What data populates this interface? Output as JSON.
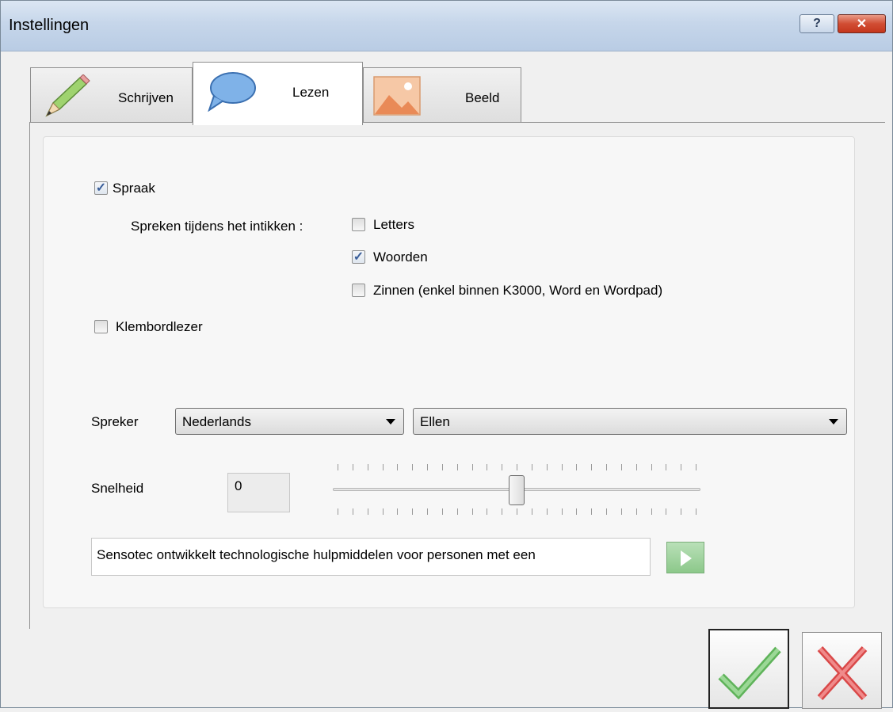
{
  "window": {
    "title": "Instellingen",
    "help_label": "?",
    "close_label": "✕"
  },
  "tabs": [
    {
      "label": "Schrijven",
      "icon": "pencil-icon",
      "active": false
    },
    {
      "label": "Lezen",
      "icon": "speech-bubble-icon",
      "active": true
    },
    {
      "label": "Beeld",
      "icon": "image-icon",
      "active": false
    }
  ],
  "speech": {
    "spraak_label": "Spraak",
    "spraak_checked": true,
    "typing_label": "Spreken tijdens het intikken :",
    "letters_label": "Letters",
    "letters_checked": false,
    "woorden_label": "Woorden",
    "woorden_checked": true,
    "zinnen_label": "Zinnen (enkel binnen K3000, Word en Wordpad)",
    "zinnen_checked": false,
    "klembord_label": "Klembordlezer",
    "klembord_checked": false
  },
  "speaker": {
    "label": "Spreker",
    "language_value": "Nederlands",
    "voice_value": "Ellen"
  },
  "speed": {
    "label": "Snelheid",
    "value": "0",
    "slider_fraction": 0.5
  },
  "sample": {
    "text": "Sensotec ontwikkelt technologische hulpmiddelen voor personen met een"
  },
  "colors": {
    "accent_check": "#3b5f9a",
    "ok_green": "#7fc97a",
    "cancel_red": "#e25252",
    "play_green": "#8cc88a"
  }
}
